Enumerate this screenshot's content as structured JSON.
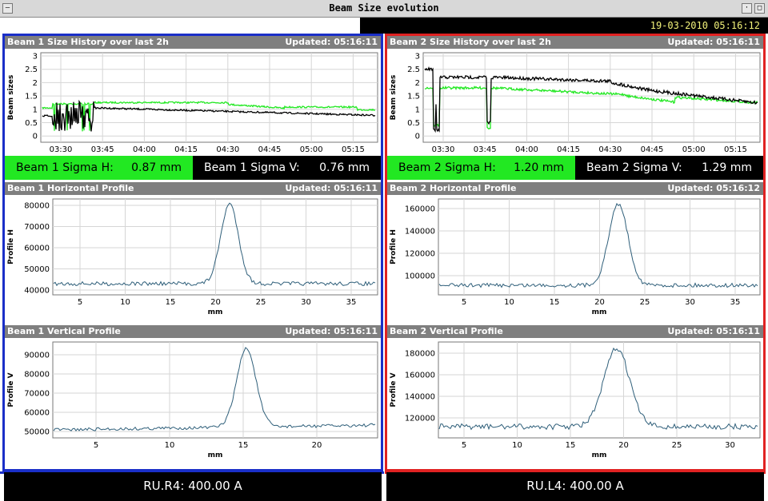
{
  "window": {
    "title": "Beam Size evolution",
    "datetime": "19-03-2010 05:16:12",
    "menu_icon": "menu-icon",
    "min_icon": "minimize-icon",
    "max_icon": "maximize-icon"
  },
  "beam1": {
    "history": {
      "title": "Beam 1 Size History over last 2h",
      "updated": "Updated: 05:16:11",
      "ylabel": "Beam sizes",
      "yticks": [
        "3",
        "2.5",
        "2",
        "1.5",
        "1",
        "0.5",
        "0"
      ],
      "xticks": [
        "03:30",
        "03:45",
        "04:00",
        "04:15",
        "04:30",
        "04:45",
        "05:00",
        "05:15"
      ]
    },
    "sigma_h_label": "Beam 1 Sigma H:",
    "sigma_h_value": "0.87 mm",
    "sigma_v_label": "Beam 1 Sigma V:",
    "sigma_v_value": "0.76 mm",
    "hprofile": {
      "title": "Beam 1 Horizontal Profile",
      "updated": "Updated: 05:16:11",
      "ylabel": "Profile H",
      "xlabel": "mm",
      "yticks": [
        "80000",
        "70000",
        "60000",
        "50000",
        "40000"
      ],
      "xticks": [
        "5",
        "10",
        "15",
        "20",
        "25",
        "30",
        "35"
      ]
    },
    "vprofile": {
      "title": "Beam 1 Vertical Profile",
      "updated": "Updated: 05:16:11",
      "ylabel": "Profile V",
      "xlabel": "mm",
      "yticks": [
        "90000",
        "80000",
        "70000",
        "60000",
        "50000"
      ],
      "xticks": [
        "5",
        "10",
        "15",
        "20"
      ]
    },
    "current": "RU.R4: 400.00 A"
  },
  "beam2": {
    "history": {
      "title": "Beam 2 Size History over last 2h",
      "updated": "Updated: 05:16:11",
      "ylabel": "Beam sizes",
      "yticks": [
        "3",
        "2.5",
        "2",
        "1.5",
        "1",
        "0.5",
        "0"
      ],
      "xticks": [
        "03:30",
        "03:45",
        "04:00",
        "04:15",
        "04:30",
        "04:45",
        "05:00",
        "05:15"
      ]
    },
    "sigma_h_label": "Beam 2 Sigma H:",
    "sigma_h_value": "1.20 mm",
    "sigma_v_label": "Beam 2 Sigma V:",
    "sigma_v_value": "1.29 mm",
    "hprofile": {
      "title": "Beam 2 Horizontal Profile",
      "updated": "Updated: 05:16:12",
      "ylabel": "Profile H",
      "xlabel": "mm",
      "yticks": [
        "160000",
        "140000",
        "120000",
        "100000"
      ],
      "xticks": [
        "5",
        "10",
        "15",
        "20",
        "25",
        "30",
        "35"
      ]
    },
    "vprofile": {
      "title": "Beam 2 Vertical Profile",
      "updated": "Updated: 05:16:11",
      "ylabel": "Profile V",
      "xlabel": "mm",
      "yticks": [
        "180000",
        "160000",
        "140000",
        "120000"
      ],
      "xticks": [
        "5",
        "10",
        "15",
        "20",
        "25",
        "30"
      ]
    },
    "current": "RU.L4: 400.00 A"
  },
  "colors": {
    "beam1_border": "#1a2fc8",
    "beam2_border": "#e02222",
    "sigma_h_bg": "#22e822",
    "sigma_v_bg": "#000000",
    "profile_line": "#2f5f7a",
    "history_h": "#22e822",
    "history_v": "#000000"
  }
}
